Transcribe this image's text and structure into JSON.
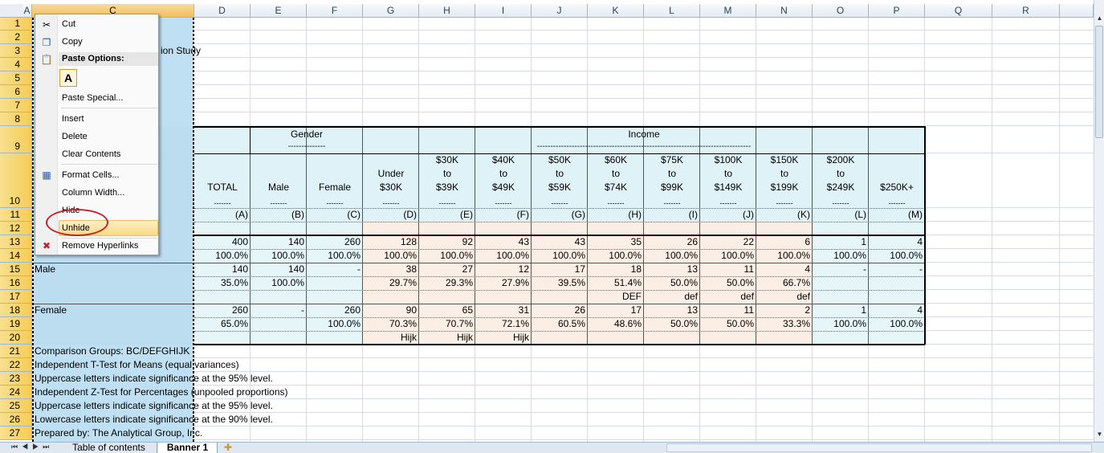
{
  "columns": [
    "A",
    "C",
    "D",
    "E",
    "F",
    "G",
    "H",
    "I",
    "J",
    "K",
    "L",
    "M",
    "N",
    "O",
    "P",
    "Q",
    "R"
  ],
  "rows": [
    "1",
    "2",
    "3",
    "4",
    "5",
    "6",
    "7",
    "8",
    "9",
    "10",
    "11",
    "12",
    "13",
    "14",
    "15",
    "16",
    "17",
    "18",
    "19",
    "20",
    "21",
    "22",
    "23",
    "24",
    "25",
    "26",
    "27"
  ],
  "sheet": {
    "title_fragment": "ion Study",
    "header": {
      "gender": "Gender",
      "income": "Income",
      "dashes_gender": "--------------",
      "dashes_income": "--------------------------------------------------------------------------------"
    },
    "banner_labels": [
      "TOTAL",
      "Male",
      "Female",
      "Under $30K",
      "$30K to $39K",
      "$40K to $49K",
      "$50K to $59K",
      "$60K to $74K",
      "$75K to $99K",
      "$100K to $149K",
      "$150K to $199K",
      "$200K to $249K",
      "$250K+"
    ],
    "underline": "-------",
    "letters": [
      "(A)",
      "(B)",
      "(C)",
      "(D)",
      "(E)",
      "(F)",
      "(G)",
      "(H)",
      "(I)",
      "(J)",
      "(K)",
      "(L)",
      "(M)"
    ],
    "row_labels": {
      "male": "Male",
      "female": "Female"
    },
    "r13": [
      "400",
      "140",
      "260",
      "128",
      "92",
      "43",
      "43",
      "35",
      "26",
      "22",
      "6",
      "1",
      "4"
    ],
    "r14": [
      "100.0%",
      "100.0%",
      "100.0%",
      "100.0%",
      "100.0%",
      "100.0%",
      "100.0%",
      "100.0%",
      "100.0%",
      "100.0%",
      "100.0%",
      "100.0%",
      "100.0%"
    ],
    "r15": [
      "140",
      "140",
      "-",
      "38",
      "27",
      "12",
      "17",
      "18",
      "13",
      "11",
      "4",
      "-",
      "-"
    ],
    "r16": [
      "35.0%",
      "100.0%",
      "",
      "29.7%",
      "29.3%",
      "27.9%",
      "39.5%",
      "51.4%",
      "50.0%",
      "50.0%",
      "66.7%",
      "",
      ""
    ],
    "r17": [
      "",
      "",
      "",
      "",
      "",
      "",
      "",
      "DEF",
      "def",
      "def",
      "def",
      "",
      ""
    ],
    "r18": [
      "260",
      "-",
      "260",
      "90",
      "65",
      "31",
      "26",
      "17",
      "13",
      "11",
      "2",
      "1",
      "4"
    ],
    "r19": [
      "65.0%",
      "",
      "100.0%",
      "70.3%",
      "70.7%",
      "72.1%",
      "60.5%",
      "48.6%",
      "50.0%",
      "50.0%",
      "33.3%",
      "100.0%",
      "100.0%"
    ],
    "r20": [
      "",
      "",
      "",
      "Hijk",
      "Hijk",
      "Hijk",
      "",
      "",
      "",
      "",
      "",
      "",
      ""
    ],
    "notes": [
      "Comparison Groups: BC/DEFGHIJK",
      "Independent T-Test for Means (equal variances)",
      "Uppercase letters indicate significance at the 95% level.",
      "Independent Z-Test for Percentages (unpooled proportions)",
      "Uppercase letters indicate significance at the 95% level.",
      "Lowercase letters indicate significance at the 90% level.",
      "Prepared by: The Analytical Group, Inc."
    ]
  },
  "context_menu": {
    "cut": "Cut",
    "copy": "Copy",
    "paste_options": "Paste Options:",
    "paste_icon": "A",
    "paste_special": "Paste Special...",
    "insert": "Insert",
    "delete": "Delete",
    "clear_contents": "Clear Contents",
    "format_cells": "Format Cells...",
    "column_width": "Column Width...",
    "hide": "Hide",
    "unhide": "Unhide",
    "remove_hyperlinks": "Remove Hyperlinks"
  },
  "tabs": {
    "toc": "Table of contents",
    "banner": "Banner 1"
  },
  "colors": {
    "header_yellow": "#f5cc57",
    "column_blue": "#bfe0f3",
    "cyan": "#e6f6f8",
    "peach": "#fbeee4",
    "highlight_circle": "#c0262a"
  }
}
